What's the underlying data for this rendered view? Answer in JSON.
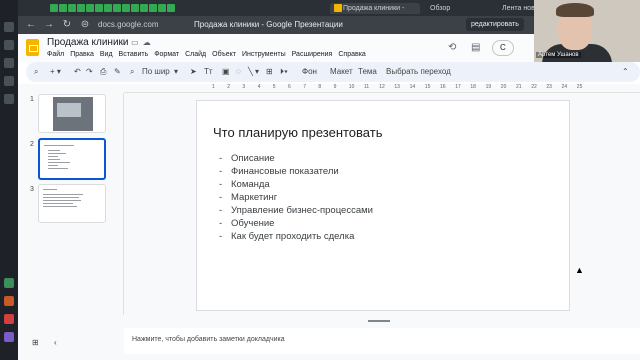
{
  "browser": {
    "tabs": [
      {
        "label": "Продажа клиники -",
        "active": true
      },
      {
        "label": "Обзор",
        "active": false
      },
      {
        "label": "Лента новос",
        "active": false
      }
    ],
    "url": "docs.google.com",
    "page_title": "Продажа клиники - Google Презентации",
    "edit_chip": "редактировать"
  },
  "doc": {
    "title": "Продажа клиники",
    "menu": [
      "Файл",
      "Правка",
      "Вид",
      "Вставить",
      "Формат",
      "Слайд",
      "Объект",
      "Инструменты",
      "Расширения",
      "Справка"
    ],
    "present_label": "С"
  },
  "toolbar": {
    "zoom": "По шир",
    "background": "Фон",
    "layout": "Макет",
    "theme": "Тема",
    "transition": "Выбрать переход"
  },
  "thumbnails": [
    {
      "number": "1"
    },
    {
      "number": "2",
      "active": true
    },
    {
      "number": "3"
    }
  ],
  "ruler_ticks": [
    "1",
    "2",
    "3",
    "4",
    "5",
    "6",
    "7",
    "8",
    "9",
    "10",
    "11",
    "12",
    "13",
    "14",
    "15",
    "16",
    "17",
    "18",
    "19",
    "20",
    "21",
    "22",
    "23",
    "24",
    "25"
  ],
  "slide": {
    "title": "Что планирую презентовать",
    "bullets": [
      "Описание",
      "Финансовые показатели",
      "Команда",
      "Маркетинг",
      "Управление бизнес-процессами",
      "Обучение",
      "Как будет проходить сделка"
    ]
  },
  "notes_placeholder": "Нажмите, чтобы добавить заметки докладчика",
  "webcam": {
    "name": "Артем Ушанов"
  },
  "colors": {
    "accent": "#0b57d0",
    "slides_yellow": "#f4b400"
  }
}
